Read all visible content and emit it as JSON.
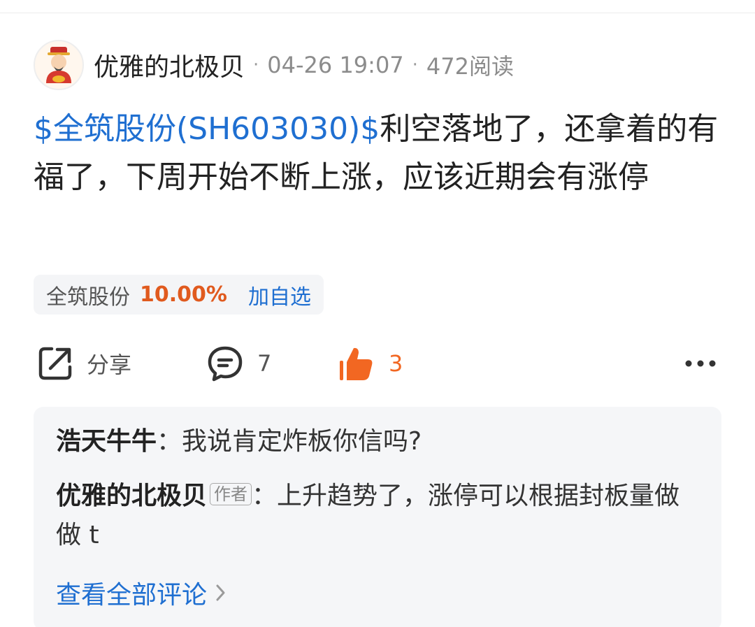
{
  "post": {
    "author": "优雅的北极贝",
    "separator": "·",
    "time": "04-26 19:07",
    "views": "472阅读",
    "stock_tag": "$全筑股份(SH603030)$",
    "body": "利空落地了，还拿着的有福了，下周开始不断上涨，应该近期会有涨停"
  },
  "stock_chip": {
    "name": "全筑股份",
    "change": "10.00%",
    "add_label": "加自选"
  },
  "actions": {
    "share_label": "分享",
    "comment_count": "7",
    "like_count": "3"
  },
  "comments": [
    {
      "author": "浩天牛牛",
      "badge": "",
      "colon": "：",
      "text": "我说肯定炸板你信吗?"
    },
    {
      "author": "优雅的北极贝",
      "badge": "作者",
      "colon": "：",
      "text": "上升趋势了，涨停可以根据封板量做做 t"
    }
  ],
  "view_all_label": "查看全部评论",
  "colors": {
    "link_blue": "#1f6fd1",
    "rise_orange": "#e05a1e",
    "like_orange": "#f26722"
  },
  "icons": {
    "share": "share-icon",
    "comment": "comment-icon",
    "like": "thumbs-up-icon",
    "more": "more-icon",
    "chevron": "chevron-right-icon"
  }
}
